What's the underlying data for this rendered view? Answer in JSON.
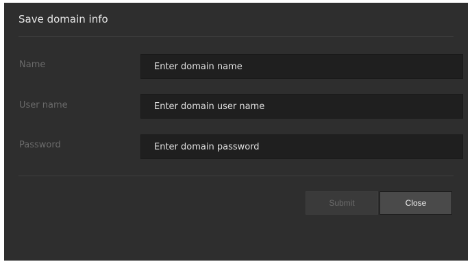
{
  "dialog": {
    "title": "Save domain info",
    "fields": [
      {
        "label": "Name",
        "placeholder": "Enter domain name",
        "value": ""
      },
      {
        "label": "User name",
        "placeholder": "Enter domain user name",
        "value": ""
      },
      {
        "label": "Password",
        "placeholder": "Enter domain password",
        "value": ""
      }
    ],
    "buttons": {
      "submit": "Submit",
      "close": "Close"
    }
  },
  "colors": {
    "dialog_background": "#2e2e2e",
    "input_background": "#1f1f1f",
    "label_text": "#6a6a6a",
    "disabled_button_text": "#6c6c6c"
  }
}
